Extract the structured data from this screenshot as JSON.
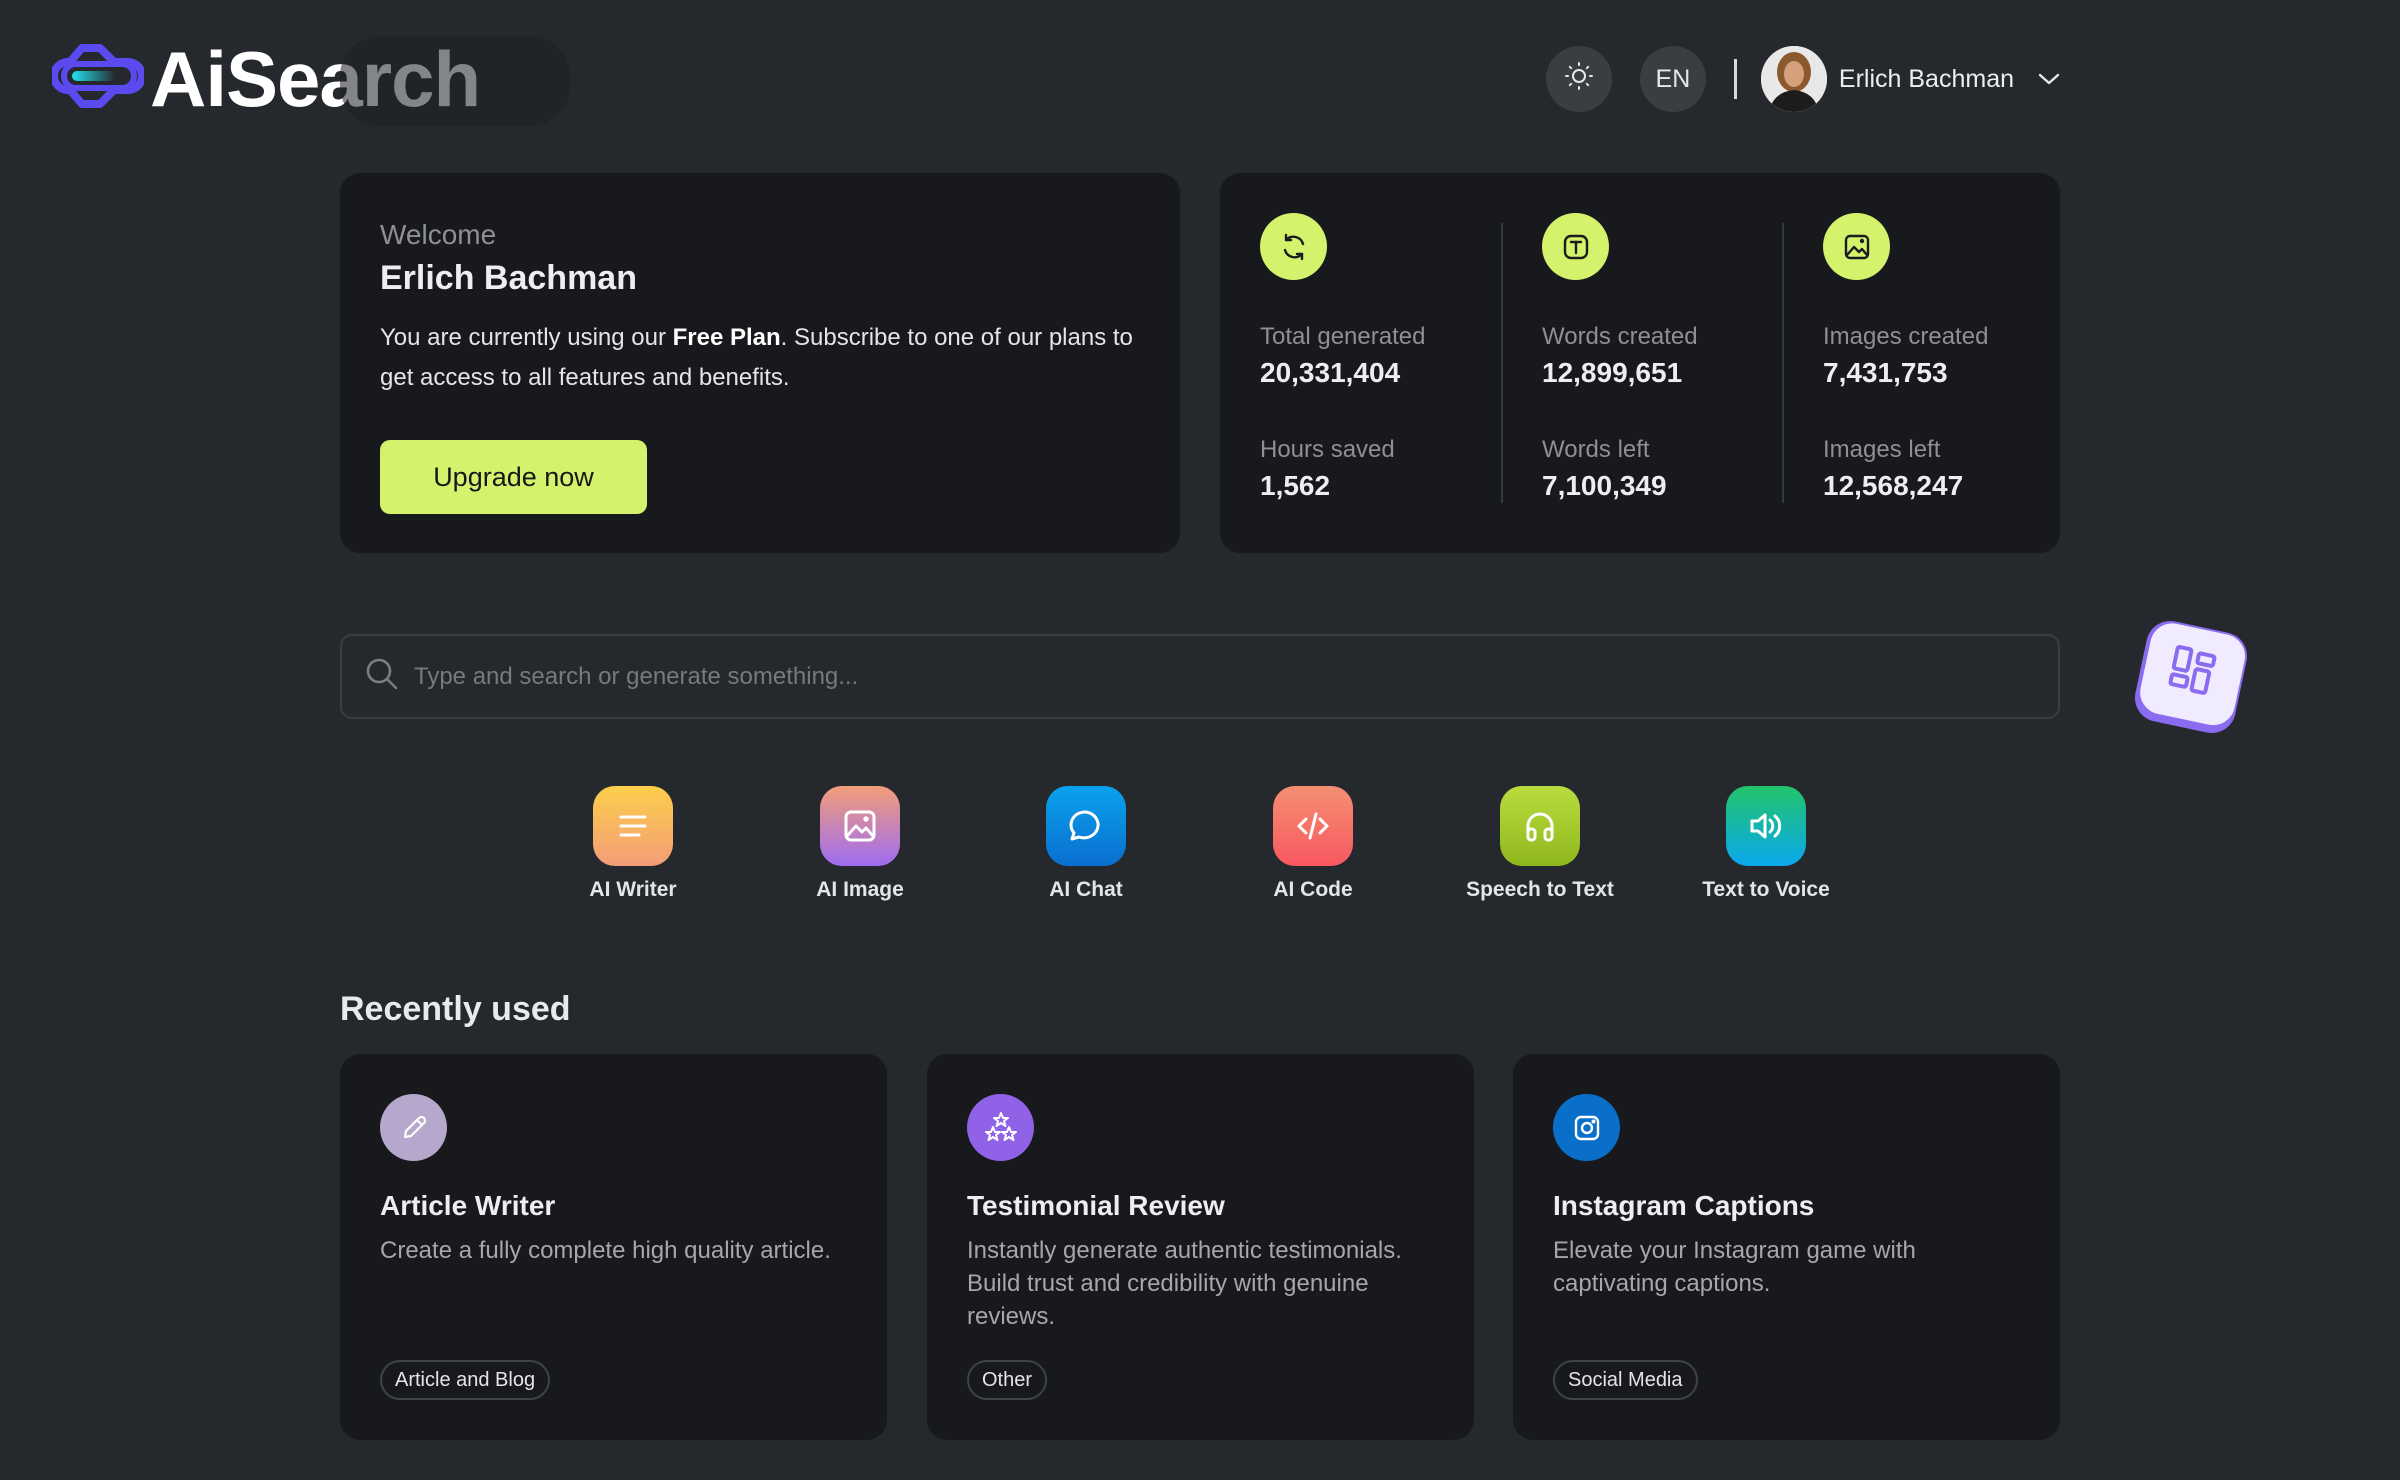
{
  "header": {
    "logo_text": "AiSearch",
    "theme_toggle_icon": "sun-icon",
    "language": "EN",
    "user_name": "Erlich Bachman",
    "user_menu_icon": "chevron-down-icon"
  },
  "welcome": {
    "greeting": "Welcome",
    "name": "Erlich Bachman",
    "desc_prefix": "You are currently using our ",
    "plan": "Free Plan",
    "desc_suffix": ". Subscribe to one of our plans to get access to all features and benefits.",
    "upgrade_label": "Upgrade now"
  },
  "stats": {
    "accent": "#d5f26c",
    "columns": [
      {
        "icon": "refresh-icon",
        "top_label": "Total generated",
        "top_value": "20,331,404",
        "bottom_label": "Hours saved",
        "bottom_value": "1,562"
      },
      {
        "icon": "text-icon",
        "top_label": "Words created",
        "top_value": "12,899,651",
        "bottom_label": "Words left",
        "bottom_value": "7,100,349"
      },
      {
        "icon": "image-icon",
        "top_label": "Images created",
        "top_value": "7,431,753",
        "bottom_label": "Images left",
        "bottom_value": "12,568,247"
      }
    ]
  },
  "search": {
    "placeholder": "Type and search or generate something...",
    "value": ""
  },
  "floating_widget": {
    "icon": "apps-grid-icon"
  },
  "tools": [
    {
      "label": "AI Writer",
      "icon": "lines-icon"
    },
    {
      "label": "AI Image",
      "icon": "image-icon"
    },
    {
      "label": "AI Chat",
      "icon": "chat-bubble-icon"
    },
    {
      "label": "AI Code",
      "icon": "code-icon"
    },
    {
      "label": "Speech to Text",
      "icon": "headphones-icon"
    },
    {
      "label": "Text to Voice",
      "icon": "speaker-icon"
    }
  ],
  "recently_used": {
    "title": "Recently used",
    "items": [
      {
        "title": "Article Writer",
        "description": "Create a fully complete high quality article.",
        "tag": "Article and Blog",
        "icon": "pencil-icon",
        "icon_color": "#b6a7cc"
      },
      {
        "title": "Testimonial Review",
        "description": "Instantly generate authentic testimonials. Build trust and credibility with genuine reviews.",
        "tag": "Other",
        "icon": "stars-icon",
        "icon_color": "#8f62e8"
      },
      {
        "title": "Instagram Captions",
        "description": "Elevate your Instagram game with captivating captions.",
        "tag": "Social Media",
        "icon": "instagram-icon",
        "icon_color": "#0a6fc9"
      }
    ]
  }
}
